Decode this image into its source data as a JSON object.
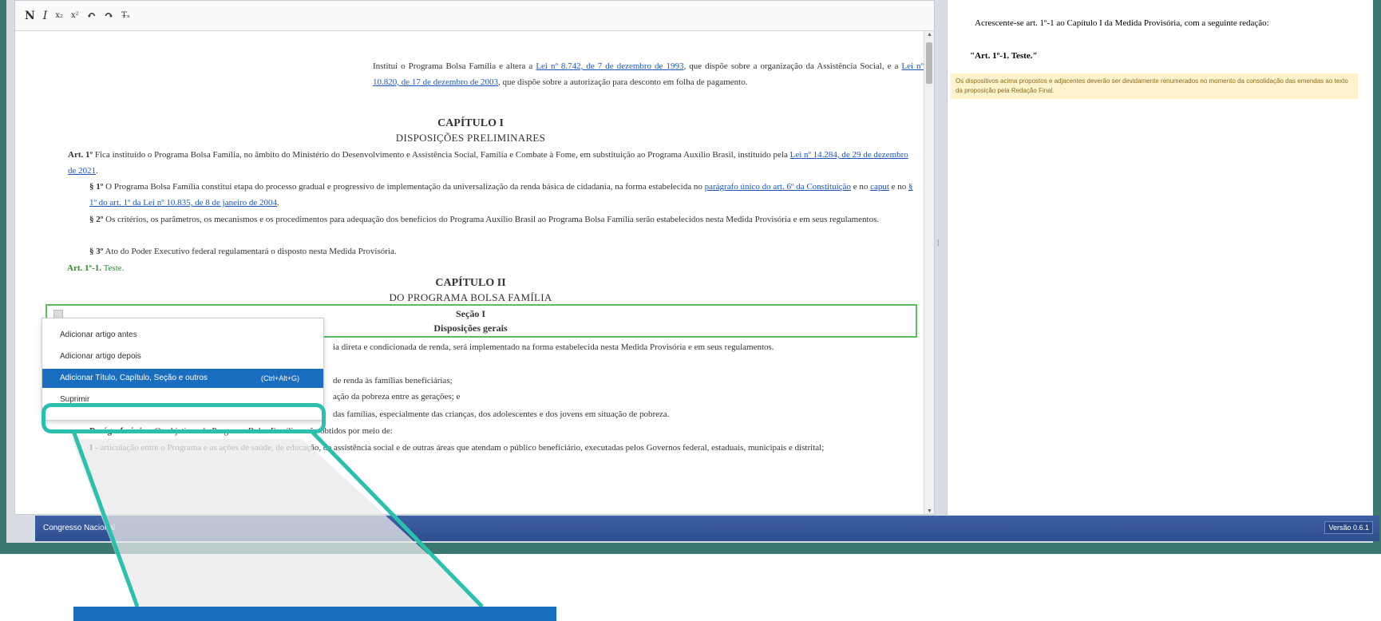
{
  "toolbar": {
    "bold": "N",
    "italic": "I",
    "subscript": "x₂",
    "superscript": "x²",
    "undo": "↶",
    "redo": "↷",
    "clear_format": "T̶ₓ"
  },
  "document": {
    "preamble_1": "Institui o Programa Bolsa Família e altera a ",
    "preamble_link_1": "Lei nº 8.742, de 7 de dezembro de 1993",
    "preamble_2": ", que dispõe sobre a organização da Assistência Social, e a ",
    "preamble_link_2": "Lei nº 10.820, de 17 de dezembro de 2003",
    "preamble_3": ", que dispõe sobre a autorização para desconto em folha de pagamento.",
    "chapter1_title": "CAPÍTULO I",
    "chapter1_sub": "DISPOSIÇÕES PRELIMINARES",
    "art1_label": "Art. 1º",
    "art1_text": " Fica instituído o Programa Bolsa Família, no âmbito do Ministério do Desenvolvimento e Assistência Social, Família e Combate à Fome, em substituição ao Programa Auxílio Brasil, instituído pela ",
    "art1_link": "Lei nº 14.284, de 29 de dezembro de 2021",
    "art1_end": ".",
    "p1_label": "§ 1º",
    "p1_text": " O Programa Bolsa Família constitui etapa do processo gradual e progressivo de implementação da universalização da renda básica de cidadania, na forma estabelecida no ",
    "p1_link1": "parágrafo único do art. 6º da Constituição",
    "p1_mid": " e no ",
    "p1_link2": "caput",
    "p1_mid2": " e no ",
    "p1_link3": "§ 1º do art. 1º da Lei nº 10.835, de 8 de janeiro de 2004",
    "p1_end": ".",
    "p2_label": "§ 2º",
    "p2_text": " Os critérios, os parâmetros, os mecanismos e os procedimentos para adequação dos benefícios do Programa Auxílio Brasil ao Programa Bolsa Família serão estabelecidos nesta Medida Provisória e em seus regulamentos.",
    "p3_label": "§ 3º",
    "p3_text": " Ato do Poder Executivo federal regulamentará o disposto nesta Medida Provisória.",
    "art1_1_label": "Art. 1º-1.",
    "art1_1_text": " Teste.",
    "chapter2_title": "CAPÍTULO II",
    "chapter2_sub": "DO PROGRAMA BOLSA FAMÍLIA",
    "section_title": "Seção I",
    "section_sub": "Disposições gerais",
    "art2_tail": "ia direta e condicionada de renda, será implementado na forma estabelecida nesta Medida Provisória e em seus regulamentos.",
    "inc1_tail": "de renda às famílias beneficiárias;",
    "inc2_tail": "ação da pobreza entre as gerações; e",
    "inc3_tail": "das famílias, especialmente das crianças, dos adolescentes e dos jovens em situação de pobreza.",
    "pu_label": "Parágrafo único.",
    "pu_text": " Os objetivos do Programa Bolsa Família serão obtidos por meio de:",
    "inc_i_label": "I",
    "inc_i_text": " - articulação entre o Programa e as ações de saúde, de educação, de assistência social e de outras áreas que atendam o público beneficiário, executadas pelos Governos federal, estaduais, municipais e distrital;"
  },
  "context_menu": {
    "items": [
      {
        "label": "Adicionar artigo antes",
        "shortcut": ""
      },
      {
        "label": "Adicionar artigo depois",
        "shortcut": ""
      },
      {
        "label": "Adicionar Título, Capítulo, Seção e outros",
        "shortcut": "(Ctrl+Alt+G)"
      },
      {
        "label": "Suprimir",
        "shortcut": ""
      }
    ],
    "highlighted_index": 2
  },
  "right_pane": {
    "text": "Acrescente-se art. 1º-1 ao Capítulo I da Medida Provisória, com a seguinte redação:",
    "article": "\"Art. 1º-1. Teste.\"",
    "note": "Os dispositivos acima propostos e adjacentes deverão ser devidamente renumerados no momento da consolidação das emendas ao texto da proposição pela Redação Final."
  },
  "status_bar": {
    "left": "Congresso Nacional",
    "version": "Versão 0.6.1"
  },
  "colors": {
    "frame": "#3b7770",
    "highlight_ring": "#2bbfae",
    "menu_highlight": "#1a6ec0",
    "section_border": "#58c05a",
    "status_bar": "#2e4f8e"
  }
}
